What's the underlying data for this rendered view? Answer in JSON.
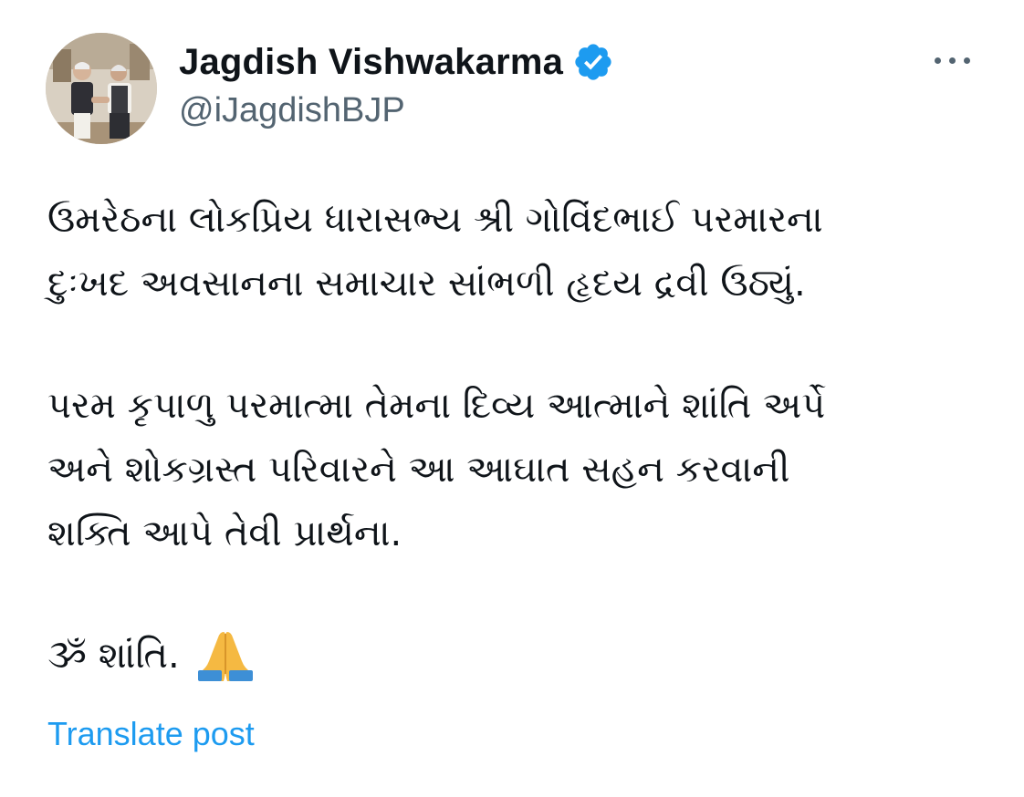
{
  "author": {
    "display_name": "Jagdish Vishwakarma",
    "handle": "@iJagdishBJP",
    "verified": true,
    "verified_icon": "verified-badge-icon",
    "verified_color": "#1d9bf0"
  },
  "menu": {
    "icon": "more-horizontal-icon"
  },
  "post": {
    "paragraph1": [
      "ઉમરેઠના લોકપ્રિય ધારાસભ્ય શ્રી ગોવિંદભાઈ પરમારના",
      "દુઃખદ અવસાનના સમાચાર સાંભળી હૃદય દ્રવી ઉઠ્યું."
    ],
    "paragraph2": [
      "પરમ કૃપાળુ પરમાત્મા તેમના દિવ્ય આત્માને શાંતિ અર્પે",
      "અને શોકગ્રસ્ત પરિવારને આ આઘાત સહન કરવાની",
      "શક્તિ આપે તેવી પ્રાર્થના."
    ],
    "closing": "ૐ શાંતિ.",
    "closing_emoji": "folded-hands-icon"
  },
  "actions": {
    "translate_label": "Translate post",
    "link_color": "#1d9bf0"
  }
}
